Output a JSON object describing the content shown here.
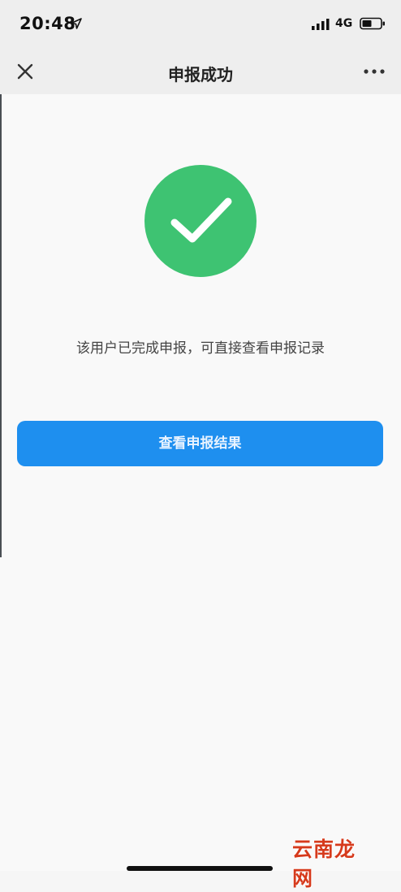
{
  "status_bar": {
    "time": "20:48",
    "network": "4G",
    "icons": [
      "location-arrow-icon",
      "signal-icon",
      "battery-icon"
    ]
  },
  "nav": {
    "title": "申报成功",
    "close_icon": "close-icon",
    "more_icon": "more-icon"
  },
  "main": {
    "success_icon": "check-circle-icon",
    "message": "该用户已完成申报，可直接查看申报记录",
    "button_label": "查看申报结果"
  },
  "watermark": {
    "text": "云南龙网"
  },
  "colors": {
    "success_green": "#3ec372",
    "button_blue": "#1e8fef",
    "watermark_red": "#d63a1c"
  }
}
